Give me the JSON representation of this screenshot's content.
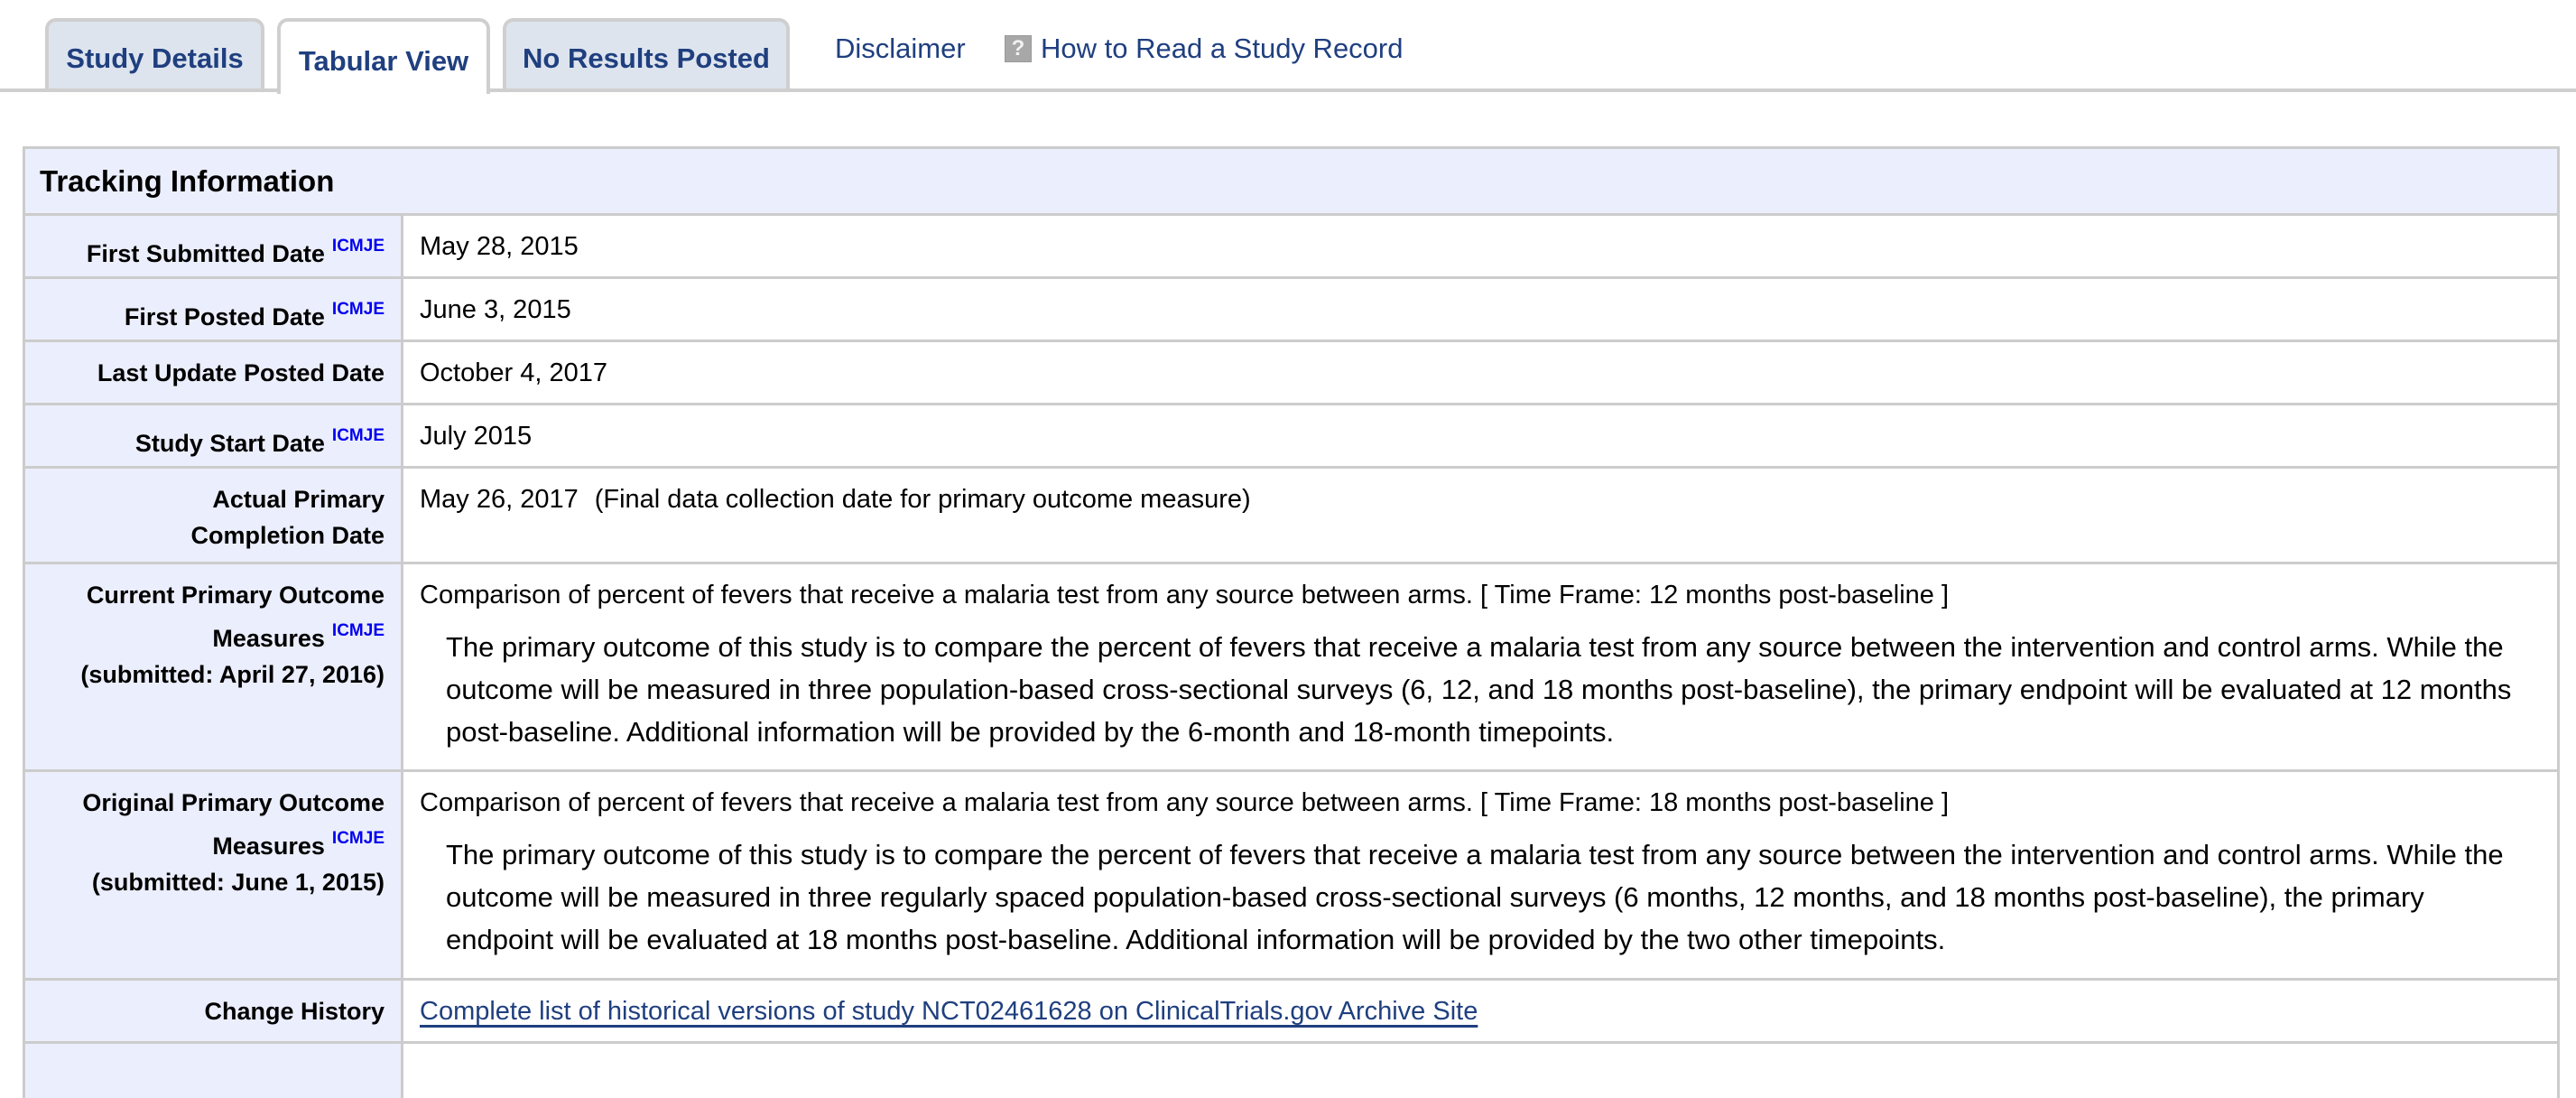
{
  "tabs": [
    {
      "label": "Study Details",
      "active": false
    },
    {
      "label": "Tabular View",
      "active": true
    },
    {
      "label": "No Results Posted",
      "active": false
    }
  ],
  "links": {
    "disclaimer": "Disclaimer",
    "how_to_read": "How to Read a Study Record",
    "help_icon_glyph": "?"
  },
  "section": {
    "title": "Tracking Information",
    "icmje": "ICMJE",
    "rows": [
      {
        "label": "First Submitted Date",
        "icmje": true,
        "value": "May 28, 2015"
      },
      {
        "label": "First Posted Date",
        "icmje": true,
        "value": "June 3, 2015"
      },
      {
        "label": "Last Update Posted Date",
        "icmje": false,
        "value": "October 4, 2017"
      },
      {
        "label": "Study Start Date",
        "icmje": true,
        "value": "July 2015"
      },
      {
        "label": "Actual Primary Completion Date",
        "icmje": false,
        "value": "May 26, 2017",
        "note": "(Final data collection date for primary outcome measure)"
      },
      {
        "label_line1": "Current Primary Outcome",
        "label_line2": "Measures",
        "label_line3": "(submitted: April 27, 2016)",
        "icmje": true,
        "value": "Comparison of percent of fevers that receive a malaria test from any source between arms. [ Time Frame: 12 months post-baseline ]",
        "description": "The primary outcome of this study is to compare the percent of fevers that receive a malaria test from any source between the intervention and control arms. While the outcome will be measured in three population-based cross-sectional surveys (6, 12, and 18 months post-baseline), the primary endpoint will be evaluated at 12 months post-baseline. Additional information will be provided by the 6-month and 18-month timepoints."
      },
      {
        "label_line1": "Original Primary Outcome",
        "label_line2": "Measures",
        "label_line3": "(submitted: June 1, 2015)",
        "icmje": true,
        "value": "Comparison of percent of fevers that receive a malaria test from any source between arms. [ Time Frame: 18 months post-baseline ]",
        "description": "The primary outcome of this study is to compare the percent of fevers that receive a malaria test from any source between the intervention and control arms. While the outcome will be measured in three regularly spaced population-based cross-sectional surveys (6 months, 12 months, and 18 months post-baseline), the primary endpoint will be evaluated at 18 months post-baseline. Additional information will be provided by the two other timepoints."
      },
      {
        "label": "Change History",
        "icmje": false,
        "link": "Complete list of historical versions of study NCT02461628 on ClinicalTrials.gov Archive Site"
      }
    ]
  },
  "colors": {
    "tab_text": "#1f3f7f",
    "tab_bg": "#dee4ee",
    "header_bg": "#ebeefc",
    "border": "#cccccc",
    "icmje_link": "#0000ee"
  }
}
